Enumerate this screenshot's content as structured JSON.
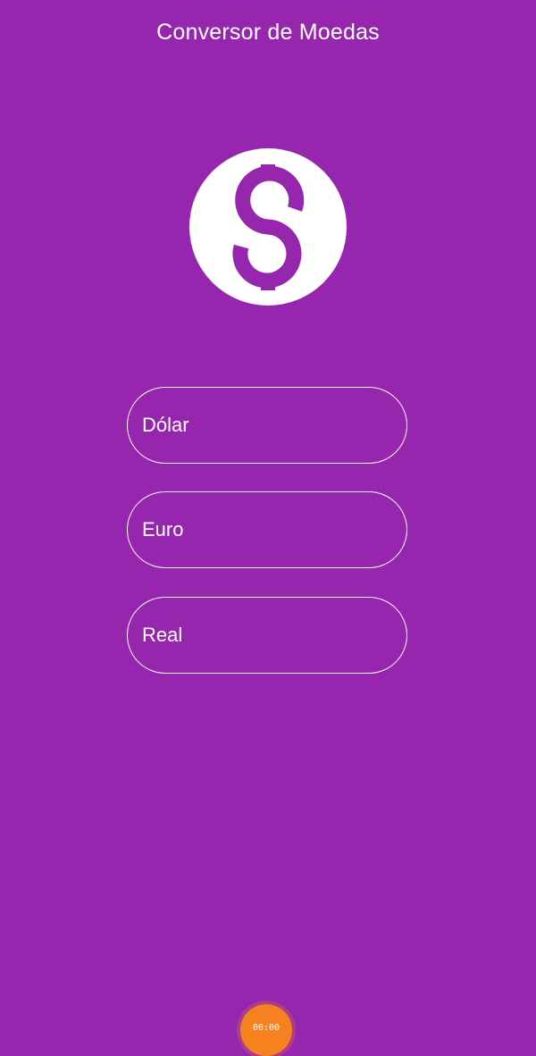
{
  "header": {
    "title": "Conversor de Moedas"
  },
  "logo": {
    "icon": "dollar-sign-icon",
    "circle_color": "#ffffff",
    "symbol_color": "#9626ad"
  },
  "fields": [
    {
      "placeholder": "Dólar",
      "value": ""
    },
    {
      "placeholder": "Euro",
      "value": ""
    },
    {
      "placeholder": "Real",
      "value": ""
    }
  ],
  "overlay": {
    "time": "00:00",
    "color": "#f5821f"
  },
  "theme": {
    "background": "#9626ad",
    "text": "#ffffff"
  }
}
